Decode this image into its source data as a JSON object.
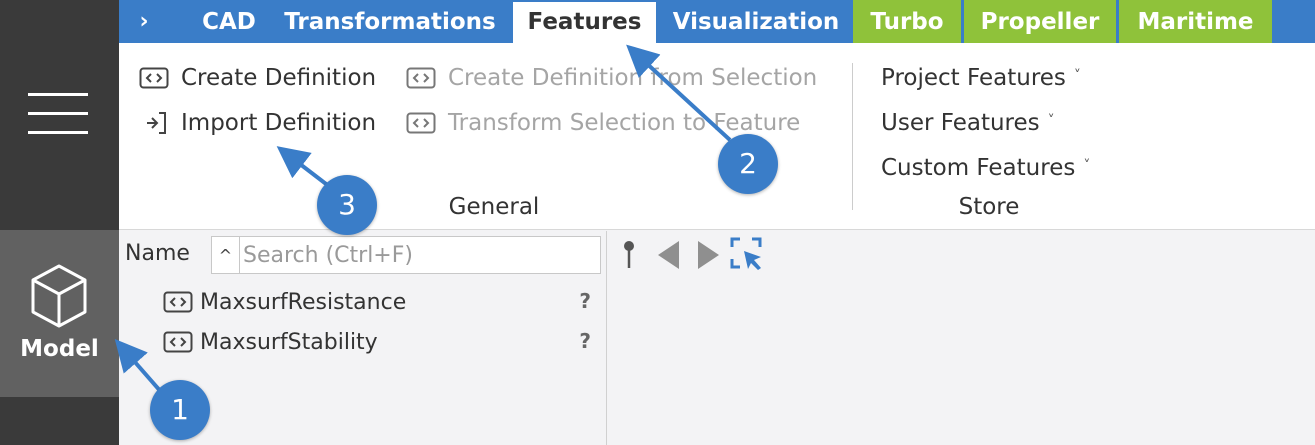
{
  "sidebar": {
    "menu_icon": "hamburger-menu-icon",
    "model_label": "Model",
    "model_icon": "cube-icon"
  },
  "tabs": {
    "expand": "›",
    "cad": "CAD",
    "transformations": "Transformations",
    "features": "Features",
    "visualization": "Visualization",
    "turbo": "Turbo",
    "propeller": "Propeller",
    "maritime": "Maritime"
  },
  "ribbon": {
    "create_definition": "Create Definition",
    "import_definition": "Import Definition",
    "create_from_selection": "Create Definition from Selection",
    "transform_selection": "Transform Selection to Feature",
    "general_label": "General",
    "project_features": "Project Features",
    "user_features": "User Features",
    "custom_features": "Custom Features",
    "store_label": "Store",
    "chevron": "˅"
  },
  "tree": {
    "name_header": "Name",
    "sort_toggle": "^",
    "search_placeholder": "Search (Ctrl+F)",
    "items": [
      {
        "label": "MaxsurfResistance",
        "help": "?"
      },
      {
        "label": "MaxsurfStability",
        "help": "?"
      }
    ]
  },
  "viewport_tools": [
    "pin-icon",
    "back-arrow-icon",
    "forward-arrow-icon",
    "select-frame-icon"
  ],
  "callouts": {
    "one": "1",
    "two": "2",
    "three": "3"
  },
  "colors": {
    "accent_blue": "#3a7dc8",
    "green_tab": "#8fc23a",
    "rail_dark": "#3a3a3a",
    "rail_active": "#616161"
  }
}
